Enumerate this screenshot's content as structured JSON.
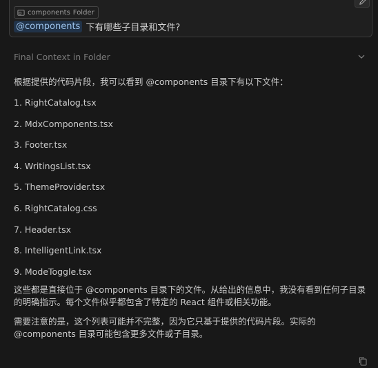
{
  "user_message": {
    "context_chip": {
      "label": "components",
      "kind": "Folder"
    },
    "mention": "@components",
    "query": "下有哪些子目录和文件?"
  },
  "context_section": {
    "title": "Final Context in Folder"
  },
  "response": {
    "intro": "根据提供的代码片段，我可以看到 @components 目录下有以下文件：",
    "files": [
      "1. RightCatalog.tsx",
      "2. MdxComponents.tsx",
      "3. Footer.tsx",
      "4. WritingsList.tsx",
      "5. ThemeProvider.tsx",
      "6. RightCatalog.css",
      "7. Header.tsx",
      "8. IntelligentLink.tsx",
      "9. ModeToggle.tsx"
    ],
    "paragraph1": "这些都是直接位于 @components 目录下的文件。从给出的信息中，我没有看到任何子目录的明确指示。每个文件似乎都包含了特定的 React 组件或相关功能。",
    "paragraph2": "需要注意的是，这个列表可能并不完整，因为它只基于提供的代码片段。实际的 @components 目录可能包含更多文件或子目录。"
  },
  "icons": {
    "chip": "folder-icon",
    "edit": "pencil-icon",
    "collapse": "chevron-down-icon",
    "copy": "copy-icon"
  },
  "colors": {
    "background": "#181818",
    "mention_bg": "#213349",
    "mention_text": "#9cc3ec"
  }
}
